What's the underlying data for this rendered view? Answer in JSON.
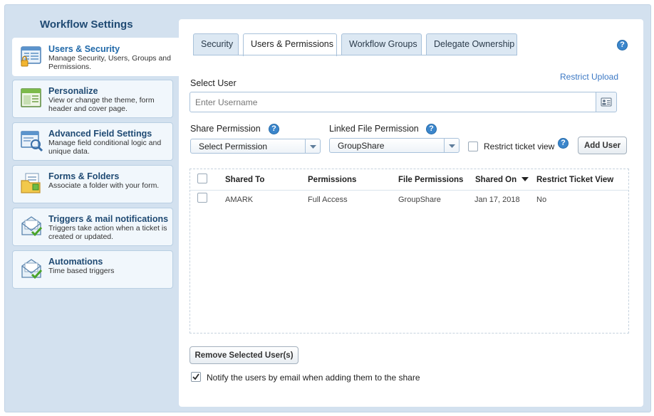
{
  "sidebar": {
    "title": "Workflow Settings",
    "items": [
      {
        "title": "Users & Security",
        "desc": "Manage Security, Users, Groups and Permissions.",
        "icon": "users-security-icon"
      },
      {
        "title": "Personalize",
        "desc": "View or change the theme, form header and cover page.",
        "icon": "personalize-icon"
      },
      {
        "title": "Advanced Field Settings",
        "desc": "Manage field conditional logic and unique data.",
        "icon": "advanced-field-icon"
      },
      {
        "title": "Forms & Folders",
        "desc": "Associate a folder with your form.",
        "icon": "folder-icon"
      },
      {
        "title": "Triggers & mail notifications",
        "desc": "Triggers take action when a ticket is created or updated.",
        "icon": "trigger-mail-icon"
      },
      {
        "title": "Automations",
        "desc": "Time based triggers",
        "icon": "automation-icon"
      }
    ]
  },
  "tabs": [
    "Security",
    "Users & Permissions",
    "Workflow Groups",
    "Delegate Ownership"
  ],
  "form": {
    "select_user_label": "Select User",
    "restrict_upload": "Restrict Upload",
    "username_placeholder": "Enter Username",
    "share_permission_label": "Share Permission",
    "share_permission_value": "Select Permission",
    "linked_permission_label": "Linked File Permission",
    "linked_permission_value": "GroupShare",
    "restrict_ticket_label": "Restrict ticket view",
    "add_user": "Add User"
  },
  "table": {
    "headers": [
      "Shared To",
      "Permissions",
      "File Permissions",
      "Shared On",
      "Restrict Ticket View"
    ],
    "rows": [
      {
        "shared_to": "AMARK",
        "permissions": "Full Access",
        "file_permissions": "GroupShare",
        "shared_on": "Jan 17, 2018",
        "restrict": "No"
      }
    ]
  },
  "footer": {
    "remove_button": "Remove Selected User(s)",
    "notify_label": "Notify the users by email when adding them to the share",
    "notify_checked": true
  },
  "colors": {
    "accent": "#3b86cc",
    "title": "#1f4a73",
    "link": "#3b78c4"
  }
}
